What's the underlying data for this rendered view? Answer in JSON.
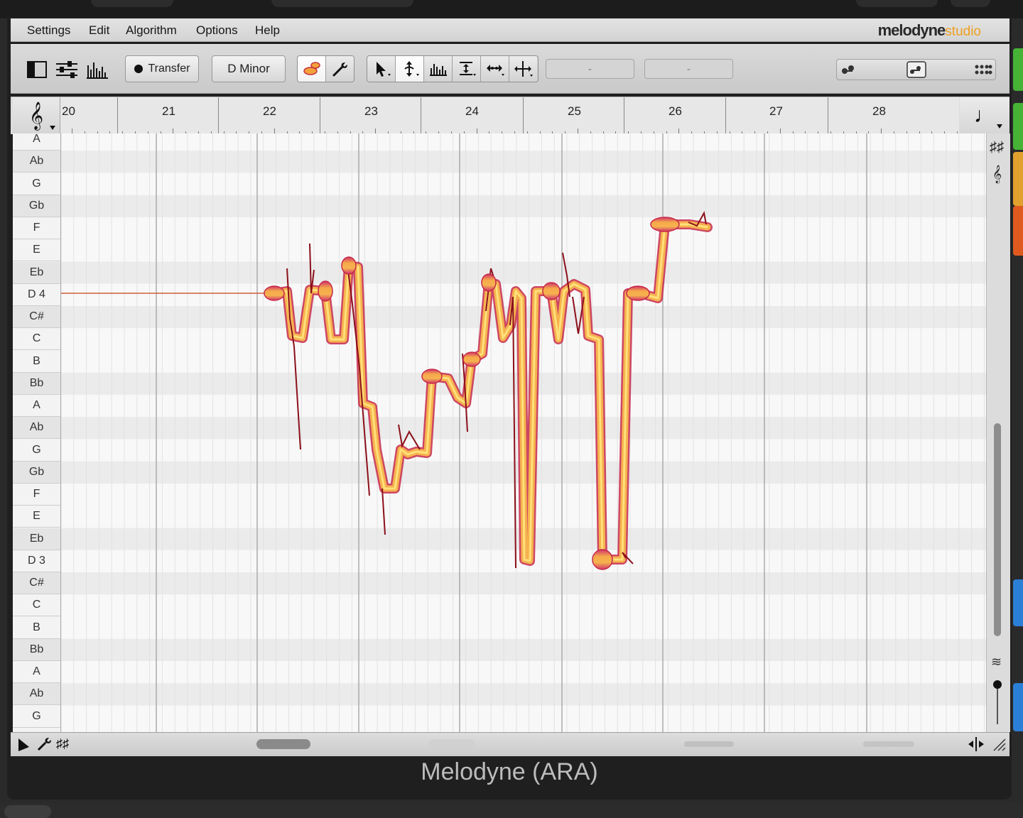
{
  "menu": {
    "items": [
      "Settings",
      "Edit",
      "Algorithm",
      "Options",
      "Help"
    ],
    "logo_main": "melodyne",
    "logo_sub": "studio"
  },
  "toolbar": {
    "transfer_label": "Transfer",
    "key_label": "D Minor",
    "field1_value": "-",
    "field2_value": "-"
  },
  "ruler": {
    "bars": [
      "20",
      "21",
      "22",
      "23",
      "24",
      "25",
      "26",
      "27",
      "28"
    ]
  },
  "pitch_keys": [
    "A",
    "Ab",
    "G",
    "Gb",
    "F",
    "E",
    "Eb",
    "D 4",
    "C#",
    "C",
    "B",
    "Bb",
    "A",
    "Ab",
    "G",
    "Gb",
    "F",
    "E",
    "Eb",
    "D 3",
    "C#",
    "C",
    "B",
    "Bb",
    "A",
    "Ab",
    "G"
  ],
  "footer": {
    "plugin_title": "Melodyne (ARA)"
  },
  "colors": {
    "blob_fill": "#f6b24f",
    "blob_edge": "#c7284a",
    "blob_core": "#ffe07a",
    "pitch_line": "#8b0f1a"
  }
}
